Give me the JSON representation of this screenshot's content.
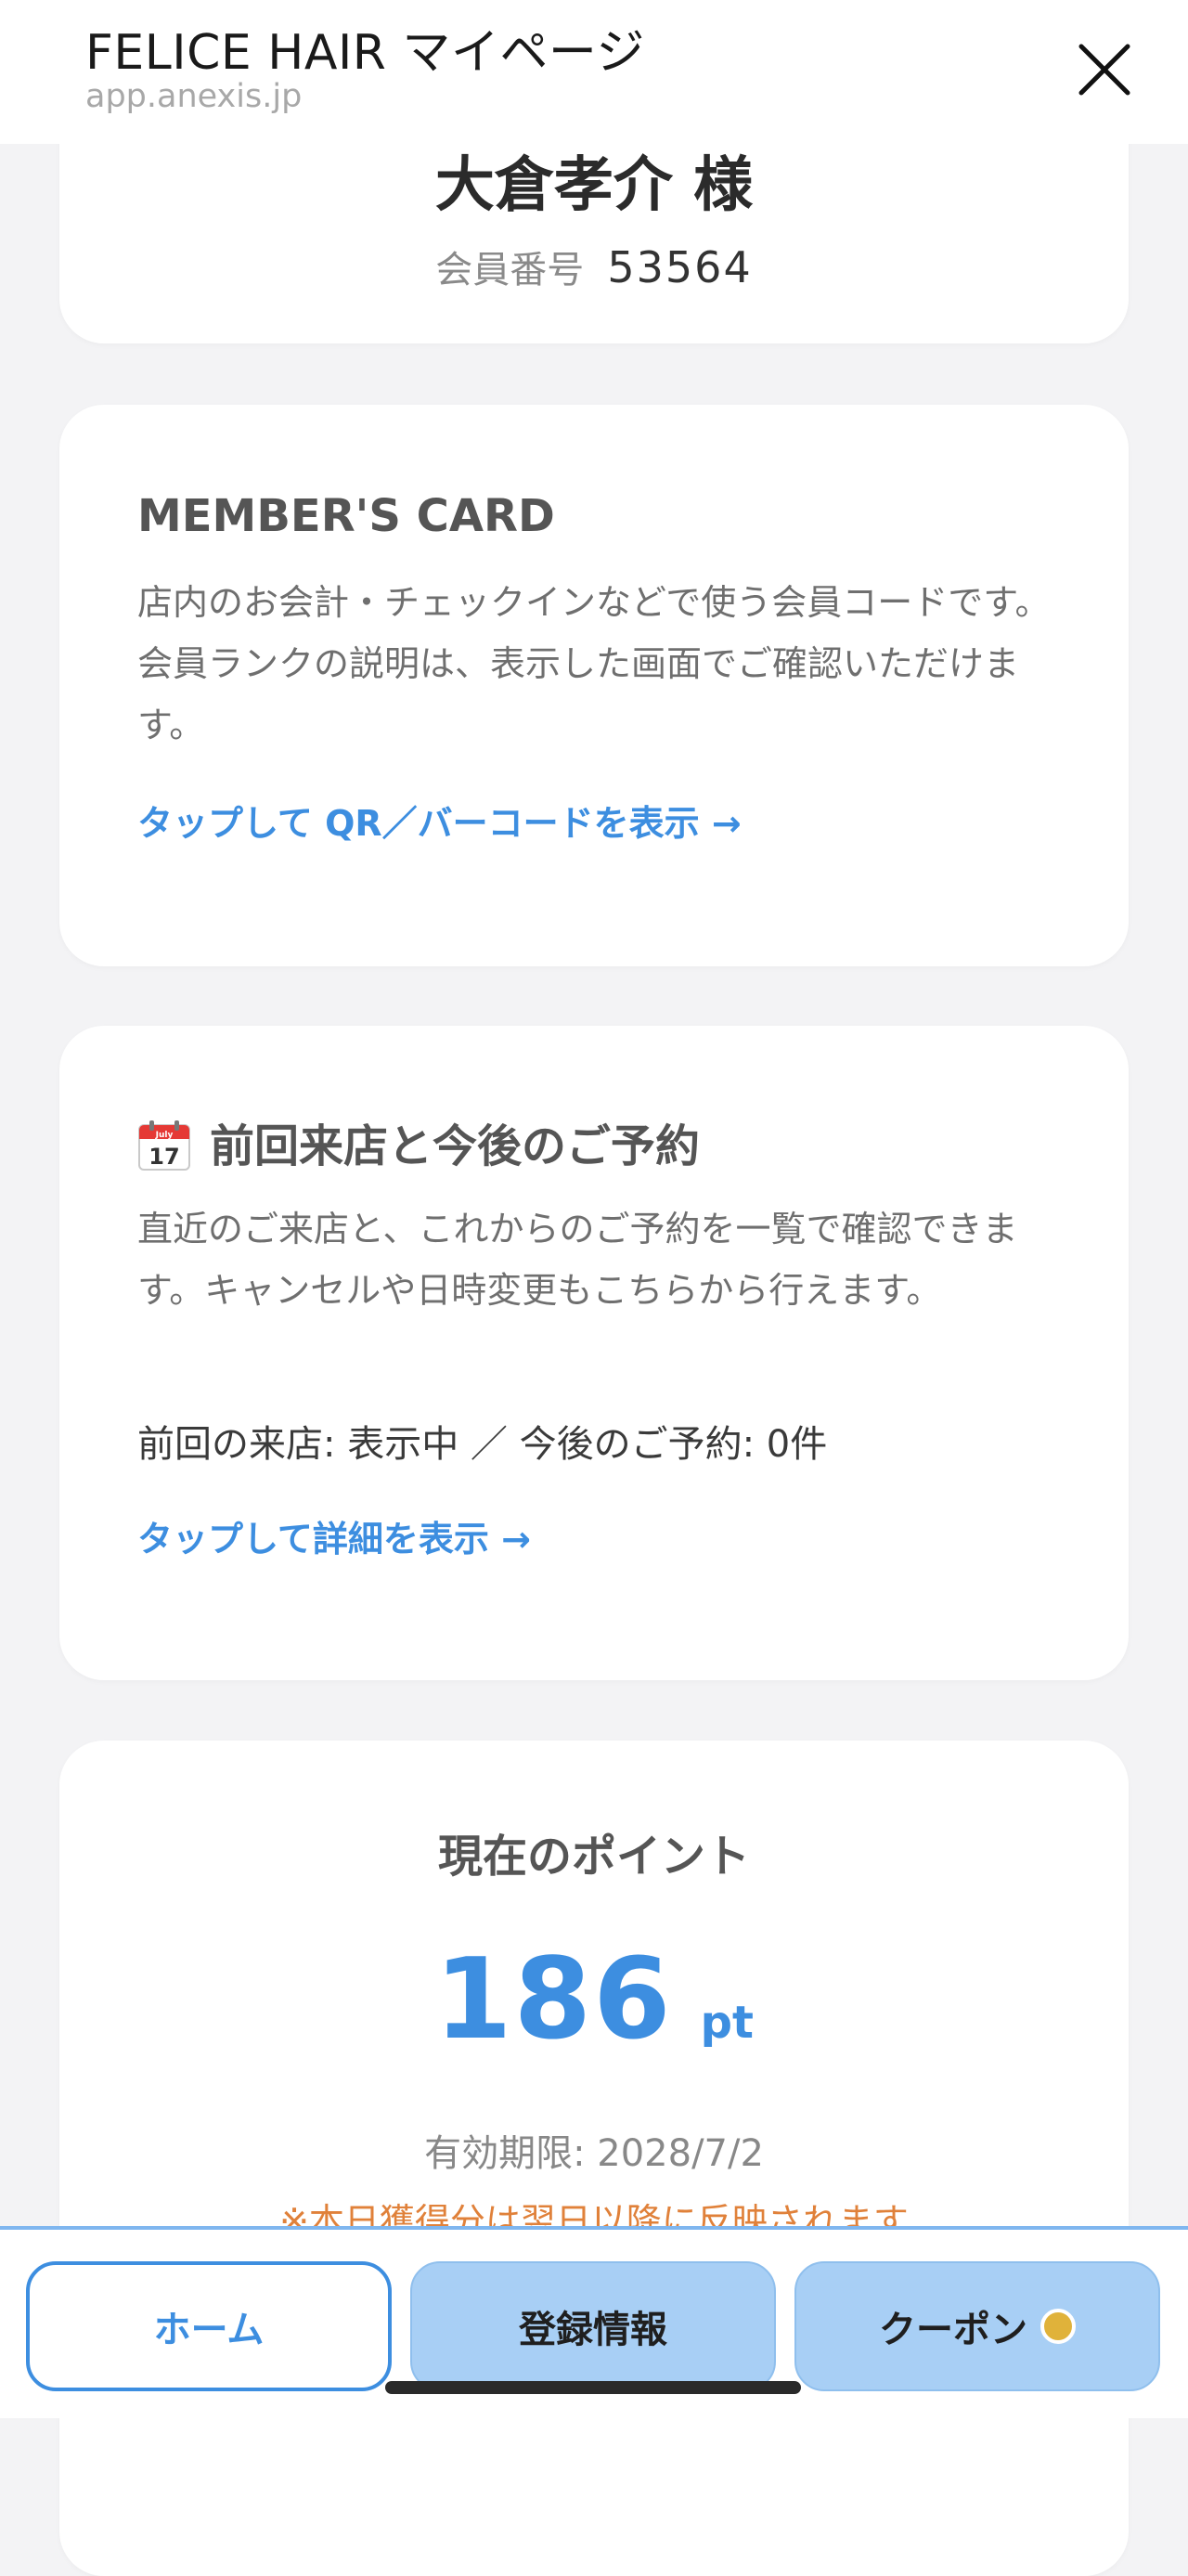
{
  "header": {
    "title": "FELICE HAIR マイページ",
    "url": "app.anexis.jp",
    "close_icon": "close-icon"
  },
  "member": {
    "name": "大倉孝介 様",
    "id_label": "会員番号",
    "id_value": "53564"
  },
  "member_card": {
    "title": "MEMBER'S CARD",
    "description": "店内のお会計・チェックインなどで使う会員コードです。会員ランクの説明は、表示した画面でご確認いただけます。",
    "link": "タップして QR／バーコードを表示 →"
  },
  "visits": {
    "icon": "calendar-icon",
    "icon_text": "17",
    "icon_month": "July",
    "title": "前回来店と今後のご予約",
    "description": "直近のご来店と、これからのご予約を一覧で確認できます。キャンセルや日時変更もこちらから行えます。",
    "summary": "前回の来店: 表示中 ／ 今後のご予約: 0件",
    "link": "タップして詳細を表示 →"
  },
  "points": {
    "title": "現在のポイント",
    "value": "186",
    "unit": "pt",
    "expiry": "有効期限: 2028/7/2",
    "note": "※本日獲得分は翌日以降に反映されます"
  },
  "bottom_nav": {
    "home": "ホーム",
    "profile": "登録情報",
    "coupon": "クーポン"
  },
  "colors": {
    "accent": "#3d8ee0",
    "nav_bg": "#a8cff5",
    "note": "#e0813a",
    "badge_dot": "#e0b23a"
  }
}
